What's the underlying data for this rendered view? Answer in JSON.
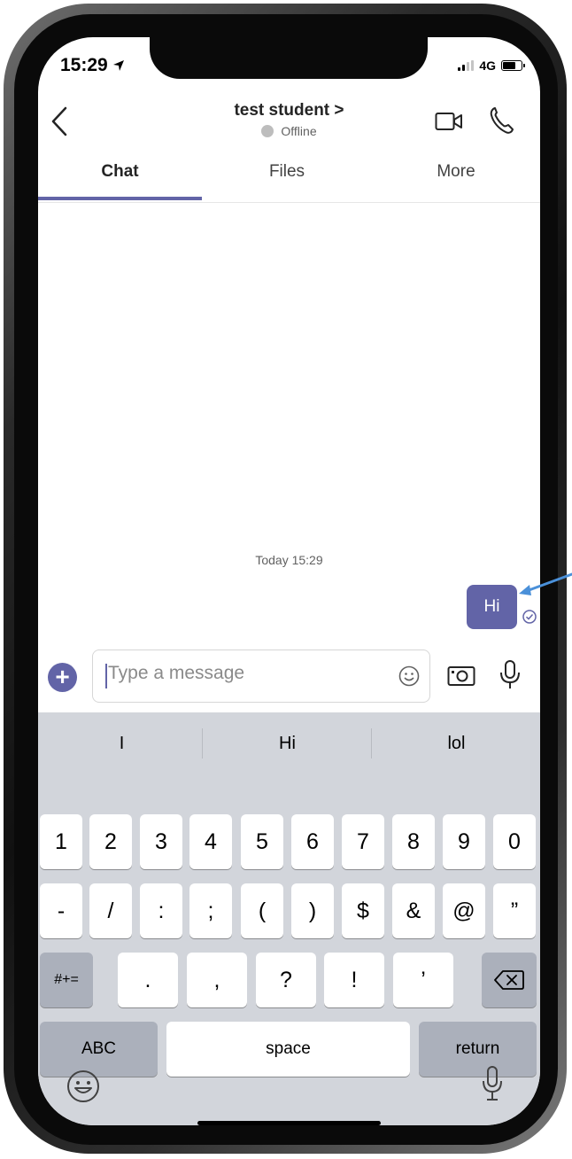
{
  "status": {
    "time": "15:29",
    "network": "4G"
  },
  "header": {
    "name": "test student",
    "presence": "Offline"
  },
  "tabs": [
    "Chat",
    "Files",
    "More"
  ],
  "chat": {
    "day_stamp": "Today 15:29",
    "message": "Hi"
  },
  "compose": {
    "placeholder": "Type a message"
  },
  "keyboard": {
    "suggestions": [
      "I",
      "Hi",
      "lol"
    ],
    "row1": [
      "1",
      "2",
      "3",
      "4",
      "5",
      "6",
      "7",
      "8",
      "9",
      "0"
    ],
    "row2": [
      "-",
      "/",
      ":",
      ";",
      "(",
      ")",
      "$",
      "&",
      "@",
      "”"
    ],
    "row3_fn": "#+=",
    "row3": [
      ".",
      ",",
      "?",
      "!",
      "’"
    ],
    "abc": "ABC",
    "space": "space",
    "return": "return"
  },
  "colors": {
    "accent": "#6264a7",
    "annotation_arrow": "#4a90d9"
  }
}
